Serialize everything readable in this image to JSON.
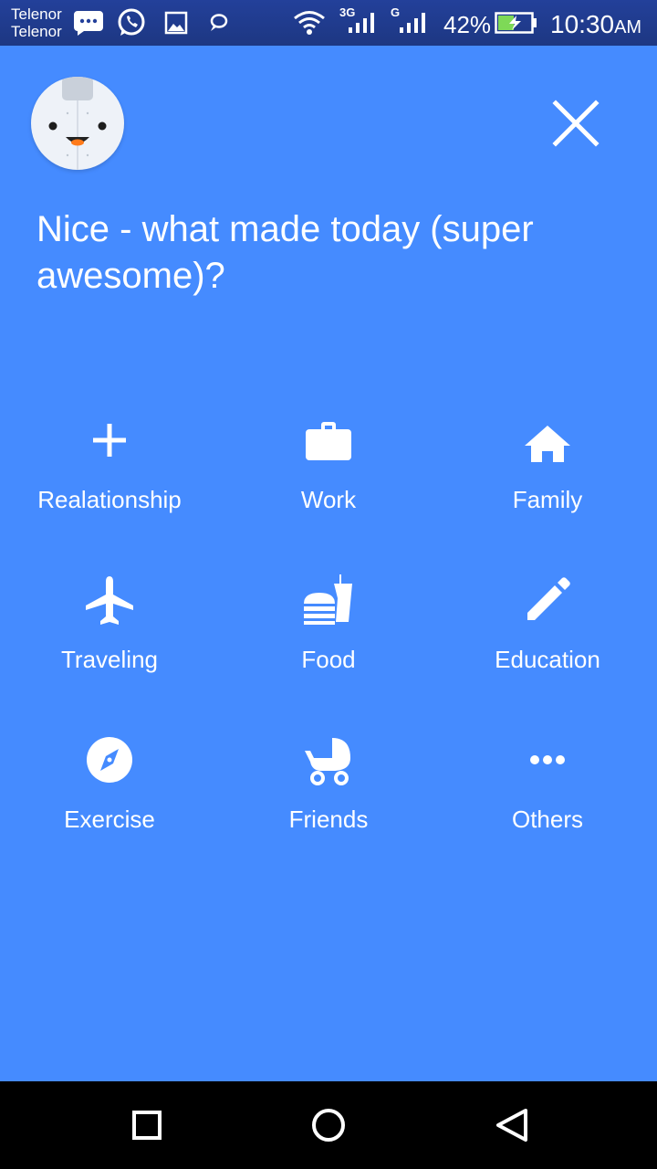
{
  "status_bar": {
    "carrier_1": "Telenor",
    "carrier_2": "Telenor",
    "network_1": "3G",
    "network_2": "G",
    "battery": "42%",
    "time": "10:30",
    "time_suffix": "AM",
    "icons": [
      "message-icon",
      "whatsapp-icon",
      "gallery-icon",
      "chat-icon",
      "wifi-icon",
      "signal-icon",
      "signal-icon",
      "battery-charging-icon"
    ]
  },
  "header": {
    "avatar_icon": "mascot-avatar-icon",
    "close_icon": "close-icon"
  },
  "question": "Nice - what made today (super awesome)?",
  "categories": [
    {
      "label": "Realationship",
      "icon": "plus-icon"
    },
    {
      "label": "Work",
      "icon": "briefcase-icon"
    },
    {
      "label": "Family",
      "icon": "home-icon"
    },
    {
      "label": "Traveling",
      "icon": "airplane-icon"
    },
    {
      "label": "Food",
      "icon": "fastfood-icon"
    },
    {
      "label": "Education",
      "icon": "pencil-icon"
    },
    {
      "label": "Exercise",
      "icon": "compass-icon"
    },
    {
      "label": "Friends",
      "icon": "stroller-icon"
    },
    {
      "label": "Others",
      "icon": "more-dots-icon"
    }
  ],
  "nav_bar": {
    "icons": [
      "recents-square-icon",
      "home-circle-icon",
      "back-triangle-icon"
    ]
  },
  "colors": {
    "background": "#458bff",
    "status_bar": "#1f3a8a",
    "nav_bar": "#000000",
    "text": "#ffffff"
  }
}
